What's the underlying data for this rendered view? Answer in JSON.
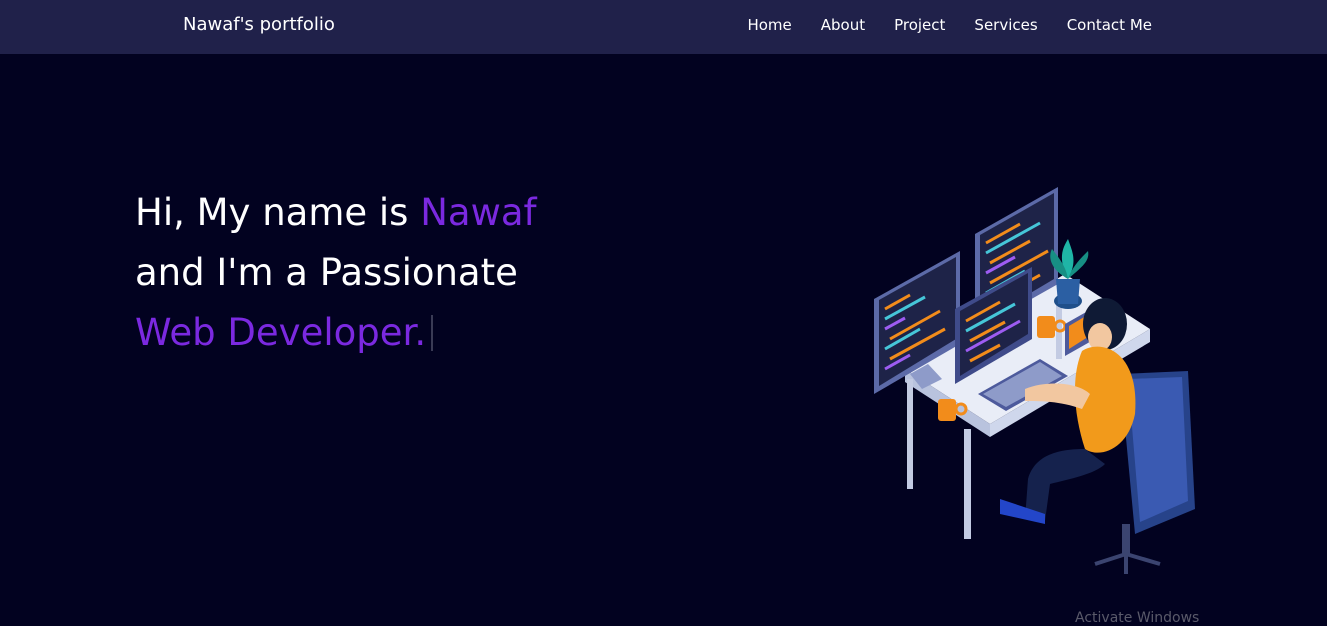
{
  "nav": {
    "brand": "Nawaf's portfolio",
    "links": [
      "Home",
      "About",
      "Project",
      "Services",
      "Contact Me"
    ]
  },
  "hero": {
    "line1_prefix": "Hi, My name is ",
    "line1_accent": "Nawaf",
    "line2": "and I'm a Passionate",
    "line3_accent": "Web Developer."
  },
  "watermark": "Activate Windows",
  "colors": {
    "nav_bg": "#20214a",
    "page_bg": "#020220",
    "accent": "#7b29e0",
    "text": "#ffffff"
  },
  "illustration": {
    "icon": "developer-at-desk-illustration"
  }
}
